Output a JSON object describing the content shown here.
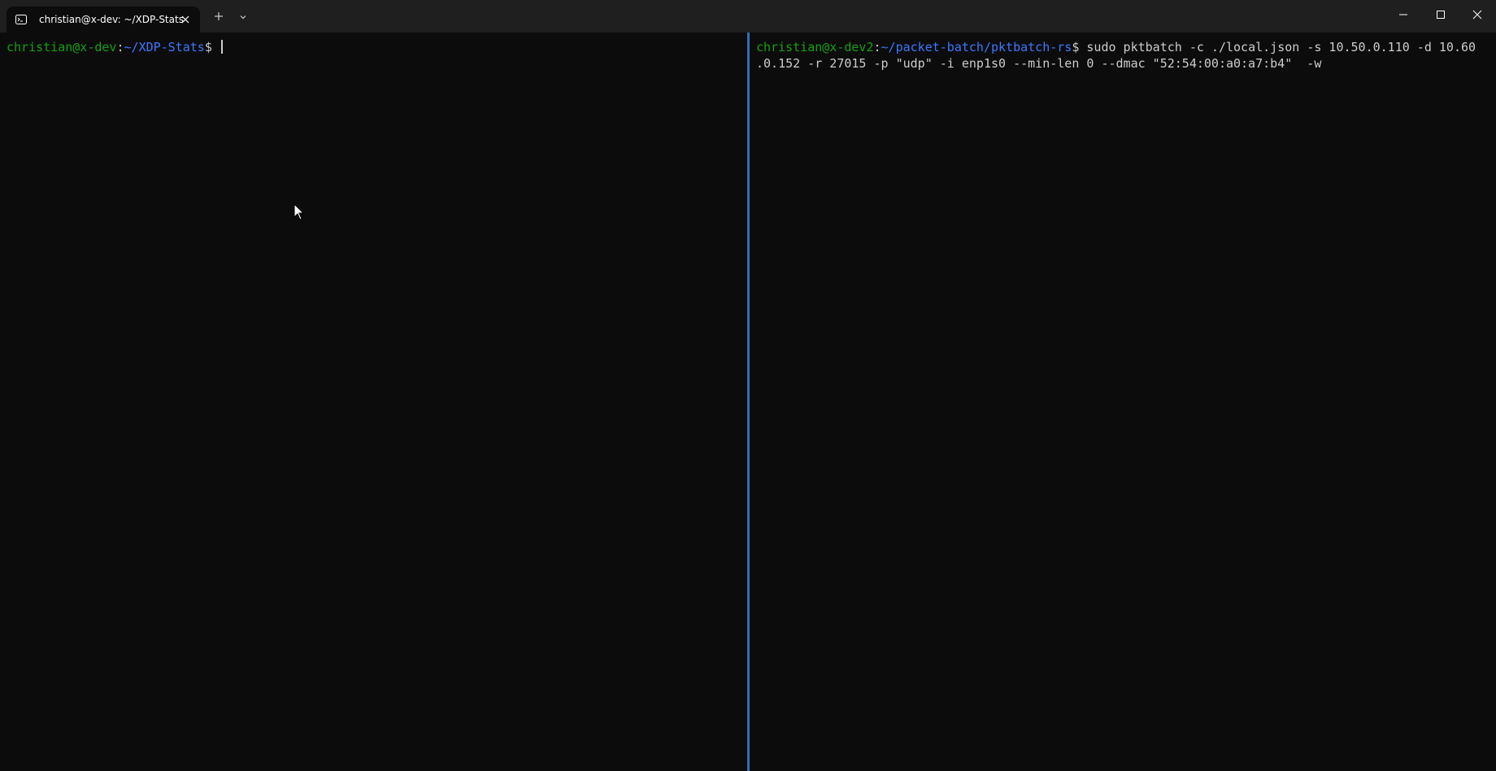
{
  "tab": {
    "title": "christian@x-dev: ~/XDP-Stats",
    "icon": "terminal-icon"
  },
  "toolbar": {
    "new_tab_icon": "plus-icon",
    "dropdown_icon": "chevron-down-icon"
  },
  "window_controls": {
    "minimize_icon": "minimize-icon",
    "maximize_icon": "maximize-icon",
    "close_icon": "close-icon"
  },
  "left_pane": {
    "user_host": "christian@x-dev",
    "sep": ":",
    "path": "~/XDP-Stats",
    "prompt": "$ "
  },
  "right_pane": {
    "user_host": "christian@x-dev2",
    "sep": ":",
    "path": "~/packet-batch/pktbatch-rs",
    "prompt": "$ ",
    "command_line1": "sudo pktbatch -c ./local.json -s 10.50.0.110 -d 10.60",
    "command_line2": ".0.152 -r 27015 -p \"udp\" -i enp1s0 --min-len 0 --dmac \"52:54:00:a0:a7:b4\"  -w"
  },
  "colors": {
    "user": "#13a10e",
    "path": "#3b78ff",
    "text": "#cccccc",
    "divider": "#2f6fb5",
    "background": "#0c0c0c",
    "titlebar": "#1f1f1f"
  }
}
